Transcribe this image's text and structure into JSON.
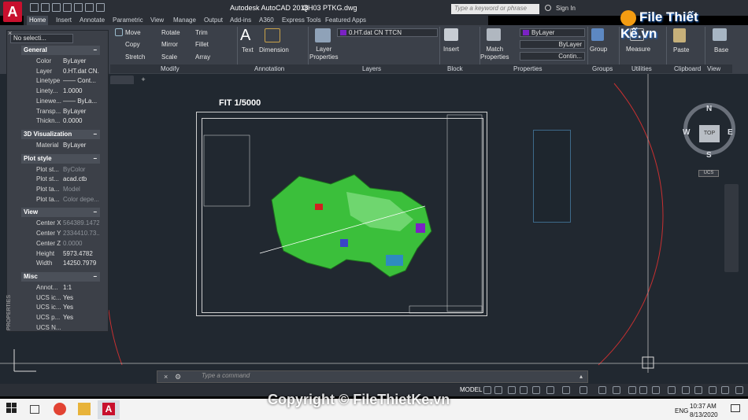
{
  "window": {
    "app_title": "Autodesk AutoCAD 2018",
    "file_title": "QH03 PTKG.dwg",
    "search_placeholder": "Type a keyword or phrase",
    "signin": "Sign In"
  },
  "ribbon_tabs": [
    "Home",
    "Insert",
    "Annotate",
    "Parametric",
    "View",
    "Manage",
    "Output",
    "Add-ins",
    "A360",
    "Express Tools",
    "Featured Apps"
  ],
  "active_tab": "Home",
  "modify": {
    "move": "Move",
    "rotate": "Rotate",
    "trim": "Trim",
    "copy": "Copy",
    "mirror": "Mirror",
    "fillet": "Fillet",
    "stretch": "Stretch",
    "scale": "Scale",
    "array": "Array"
  },
  "annotation": {
    "text": "Text",
    "dimension": "Dimension"
  },
  "layers": {
    "layer_properties": "Layer\nProperties",
    "current_layer": "0.HT.dat CN TTCN"
  },
  "block": {
    "insert": "Insert"
  },
  "properties_panel": {
    "match": "Match\nProperties",
    "color": "ByLayer",
    "linetype": "ByLayer",
    "lineweight": "Contin..."
  },
  "groups": {
    "group": "Group"
  },
  "utilities": {
    "measure": "Measure"
  },
  "clipboard": {
    "paste": "Paste"
  },
  "view_panel": {
    "base": "Base"
  },
  "panel_titles": [
    "Modify",
    "Annotation",
    "Layers",
    "Block",
    "Properties",
    "Groups",
    "Utilities",
    "Clipboard",
    "View"
  ],
  "props_palette": {
    "selection": "No selecti...",
    "sections": [
      {
        "name": "General",
        "rows": [
          [
            "Color",
            "ByLayer",
            false
          ],
          [
            "Layer",
            "0.HT.dat CN...",
            false
          ],
          [
            "Linetype",
            "—— Cont...",
            false
          ],
          [
            "Linety...",
            "1.0000",
            false
          ],
          [
            "Linewe...",
            "—— ByLa...",
            false
          ],
          [
            "Transp...",
            "ByLayer",
            false
          ],
          [
            "Thickn...",
            "0.0000",
            false
          ]
        ]
      },
      {
        "name": "3D Visualization",
        "rows": [
          [
            "Material",
            "ByLayer",
            false
          ]
        ]
      },
      {
        "name": "Plot style",
        "rows": [
          [
            "Plot st...",
            "ByColor",
            true
          ],
          [
            "Plot st...",
            "acad.ctb",
            false
          ],
          [
            "Plot ta...",
            "Model",
            true
          ],
          [
            "Plot ta...",
            "Color depe...",
            true
          ]
        ]
      },
      {
        "name": "View",
        "rows": [
          [
            "Center X",
            "564389.1472",
            true
          ],
          [
            "Center Y",
            "2334410.73...",
            true
          ],
          [
            "Center Z",
            "0.0000",
            true
          ],
          [
            "Height",
            "5973.4782",
            false
          ],
          [
            "Width",
            "14250.7979",
            false
          ]
        ]
      },
      {
        "name": "Misc",
        "rows": [
          [
            "Annot...",
            "1:1",
            false
          ],
          [
            "UCS ic...",
            "Yes",
            false
          ],
          [
            "UCS ic...",
            "Yes",
            false
          ],
          [
            "UCS p...",
            "Yes",
            false
          ],
          [
            "UCS N...",
            "",
            false
          ]
        ]
      }
    ],
    "side_label": "PROPERTIES"
  },
  "drawing": {
    "scale_label": "FIT 1/5000"
  },
  "viewcube": {
    "n": "N",
    "s": "S",
    "e": "E",
    "w": "W",
    "top": "TOP",
    "ucs": "UCS"
  },
  "command": {
    "placeholder": "Type a command"
  },
  "status": {
    "model": "MODEL"
  },
  "taskbar": {
    "time": "10:37 AM",
    "date": "8/13/2020",
    "lang": "ENG"
  },
  "watermark": "Copyright © FileThietKe.vn",
  "logo": "File Thiết Kế.vn",
  "colors": {
    "accent": "#1a73e8",
    "ribbon": "#3b4049",
    "canvas": "#212830",
    "autocad_red": "#c8102e"
  }
}
